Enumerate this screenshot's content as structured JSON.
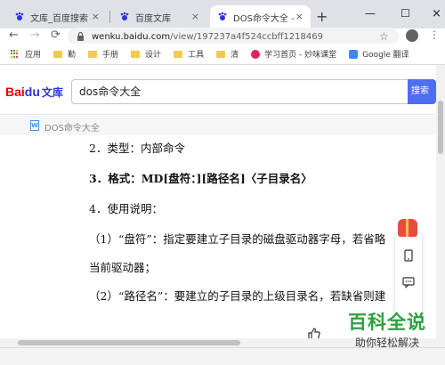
{
  "browser": {
    "tabs": [
      {
        "label": "文库_百度搜索"
      },
      {
        "label": "百度文库"
      },
      {
        "label": "DOS命令大全 - 百度"
      }
    ],
    "url_host": "wenku.baidu.com",
    "url_path": "/view/197237a4f524ccbff1218469",
    "icons": {
      "back": "←",
      "forward": "→",
      "reload": "⟳",
      "star": "☆",
      "menu": "⋮",
      "new_tab": "+",
      "close": "×",
      "minimize": "—",
      "maximize": "☐"
    }
  },
  "bookmarks": [
    {
      "label": "应用"
    },
    {
      "label": "勤"
    },
    {
      "label": "手册"
    },
    {
      "label": "设计"
    },
    {
      "label": "工具"
    },
    {
      "label": "清"
    },
    {
      "label": "学习首页 - 妙味课堂"
    },
    {
      "label": "Google 翻译"
    }
  ],
  "baidu": {
    "logo_bai": "Bai",
    "logo_paw": "du",
    "logo_wenku": "文库",
    "search_value": "dos命令大全",
    "search_button": "搜索"
  },
  "doc": {
    "title": "DOS命令大全",
    "icon_letter": "W",
    "lines": [
      "2．类型：内部命令",
      "3．格式：MD[盘符：][路径名]〈子目录名〉",
      "4．使用说明：",
      "（1）“盘符”：指定要建立子目录的磁盘驱动器字母，若省略",
      "当前驱动器；",
      "（2）“路径名”：要建立的子目录的上级目录名，若缺省则建"
    ]
  },
  "watermark": {
    "main": "百科全说",
    "sub": "助你轻松解决"
  }
}
